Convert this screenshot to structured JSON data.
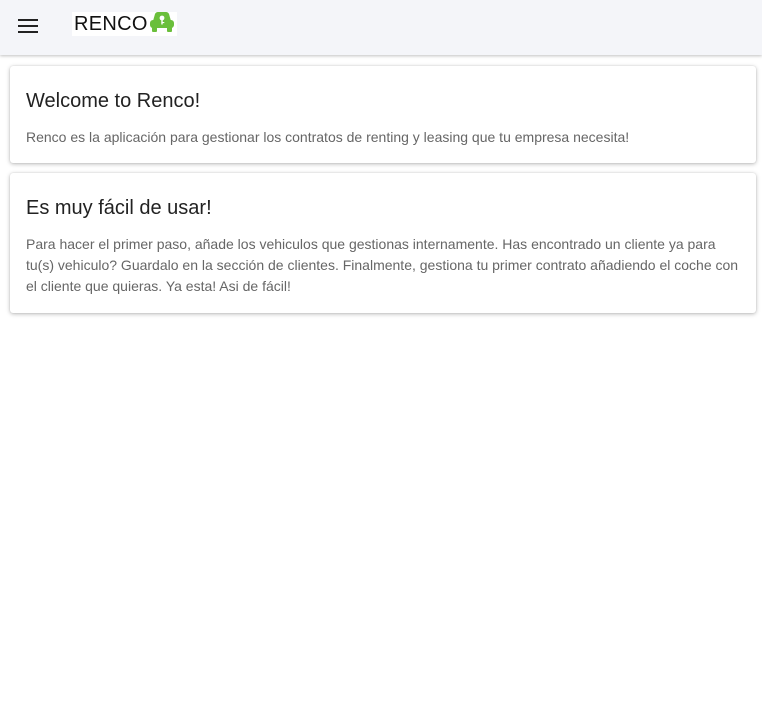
{
  "header": {
    "menu_icon": "hamburger-menu-icon",
    "logo_text": "RENCO",
    "logo_icon": "car-icon",
    "logo_color": "#6abf3b"
  },
  "cards": [
    {
      "title": "Welcome to Renco!",
      "text": "Renco es la aplicación para gestionar los contratos de renting y leasing que tu empresa necesita!"
    },
    {
      "title": "Es muy fácil de usar!",
      "text": "Para hacer el primer paso, añade los vehiculos que gestionas internamente. Has encontrado un cliente ya para tu(s) vehiculo? Guardalo en la sección de clientes. Finalmente, gestiona tu primer contrato añadiendo el coche con el cliente que quieras. Ya esta! Asi de fácil!"
    }
  ]
}
